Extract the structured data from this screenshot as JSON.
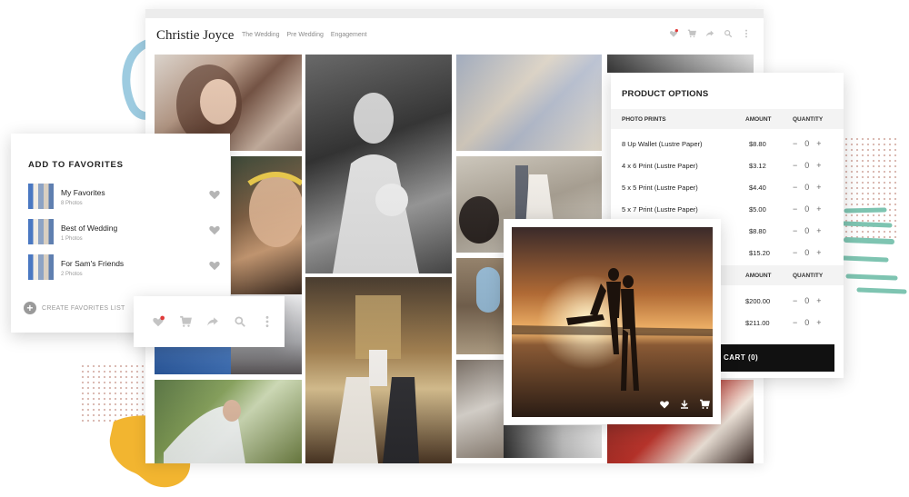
{
  "colors": {
    "accent_teal": "#7ec4b1",
    "accent_yellow": "#f2b530",
    "accent_blue": "#9dcbe0",
    "notification_dot": "#e03b3b",
    "cart_button_bg": "#111111"
  },
  "gallery": {
    "brand": "Christie Joyce",
    "nav": [
      "The Wedding",
      "Pre Wedding",
      "Engagement"
    ],
    "icons": [
      "heart-icon",
      "cart-icon",
      "share-icon",
      "search-icon",
      "more-icon"
    ]
  },
  "favorites": {
    "title": "ADD TO FAVORITES",
    "items": [
      {
        "title": "My Favorites",
        "count": "8 Photos"
      },
      {
        "title": "Best of Wedding",
        "count": "1 Photos"
      },
      {
        "title": "For Sam's Friends",
        "count": "2 Photos"
      }
    ],
    "create_label": "CREATE FAVORITES LIST"
  },
  "product": {
    "title": "PRODUCT OPTIONS",
    "section1": {
      "name": "PHOTO PRINTS",
      "amount_label": "AMOUNT",
      "quantity_label": "QUANTITY"
    },
    "prints": [
      {
        "name": "8 Up Wallet (Lustre Paper)",
        "amount": "$8.80",
        "qty": "0"
      },
      {
        "name": "4 x 6 Print (Lustre Paper)",
        "amount": "$3.12",
        "qty": "0"
      },
      {
        "name": "5 x 5 Print (Lustre Paper)",
        "amount": "$4.40",
        "qty": "0"
      },
      {
        "name": "5 x 7 Print (Lustre Paper)",
        "amount": "$5.00",
        "qty": "0"
      },
      {
        "name": "",
        "amount": "$8.80",
        "qty": "0"
      },
      {
        "name": "",
        "amount": "$15.20",
        "qty": "0"
      }
    ],
    "section2": {
      "amount_label": "AMOUNT",
      "quantity_label": "QUANTITY"
    },
    "others": [
      {
        "amount": "$200.00",
        "qty": "0"
      },
      {
        "amount": "$211.00",
        "qty": "0"
      }
    ],
    "cart_label": "CART (0)",
    "minus": "−",
    "plus": "+"
  }
}
